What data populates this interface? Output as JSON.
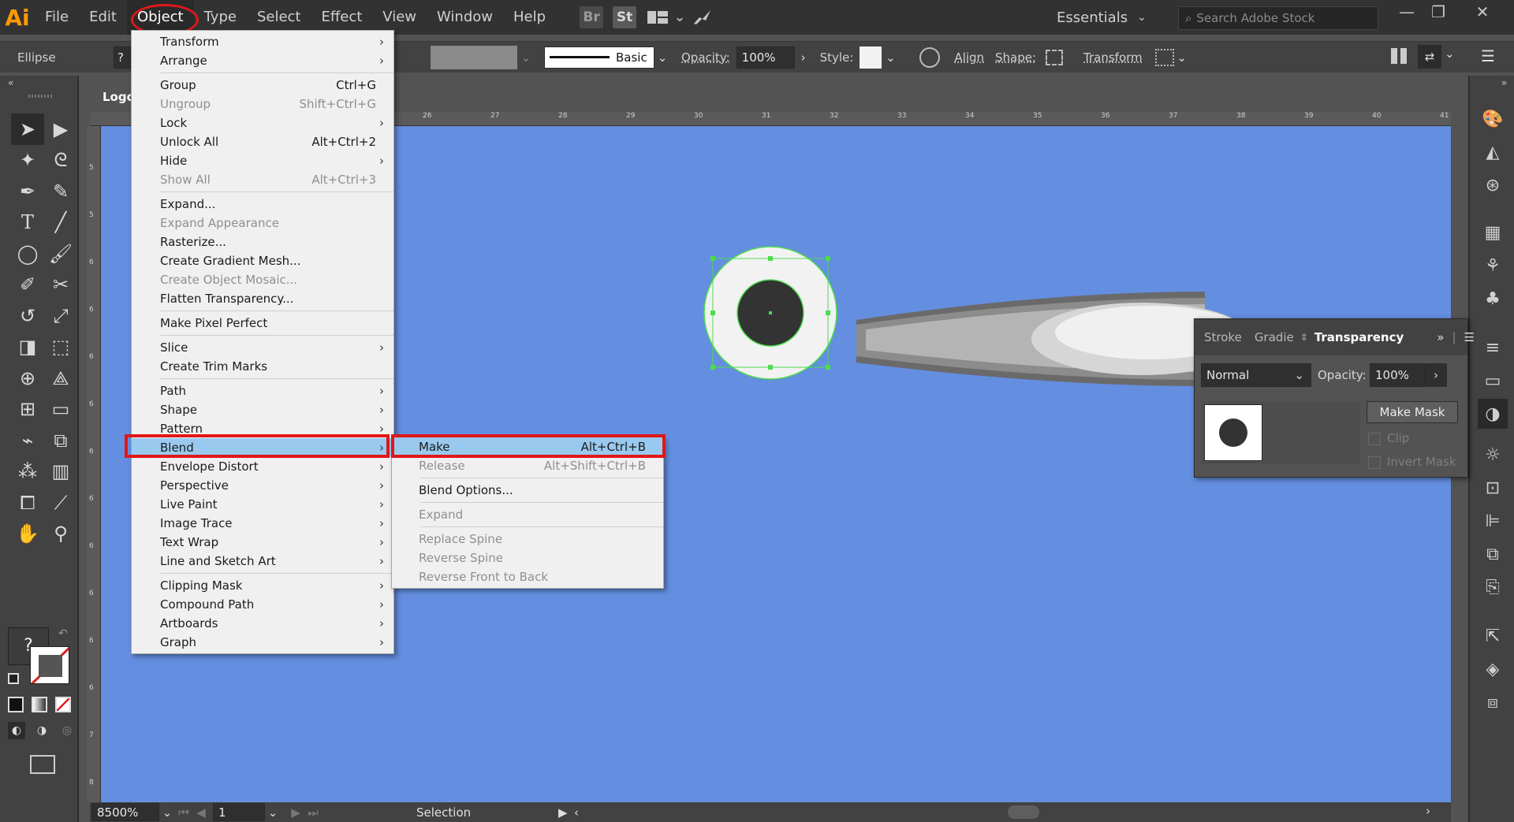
{
  "app": {
    "logo": "Ai",
    "menus": [
      "File",
      "Edit",
      "Object",
      "Type",
      "Select",
      "Effect",
      "View",
      "Window",
      "Help"
    ],
    "active_menu": "Object",
    "bridge_icon": "Br",
    "stock_icon": "St",
    "workspace": "Essentials",
    "search_placeholder": "Search Adobe Stock"
  },
  "control_bar": {
    "selection_type": "Ellipse",
    "stroke_profile": "Basic",
    "opacity_label": "Opacity:",
    "opacity_value": "100%",
    "style_label": "Style:",
    "align_label": "Align",
    "shape_label": "Shape:",
    "transform_label": "Transform"
  },
  "document": {
    "tab_title": "Logo."
  },
  "ruler": {
    "top_ticks": [
      "26",
      "27",
      "28",
      "29",
      "30",
      "31",
      "32",
      "33",
      "34",
      "35",
      "36",
      "37",
      "38",
      "39",
      "40",
      "41"
    ],
    "left_ticks": [
      "5",
      "5",
      "6",
      "6",
      "6",
      "6",
      "6",
      "6",
      "6",
      "6",
      "6",
      "6",
      "7",
      "8"
    ]
  },
  "object_menu": {
    "groups": [
      [
        {
          "label": "Transform",
          "submenu": true
        },
        {
          "label": "Arrange",
          "submenu": true
        }
      ],
      [
        {
          "label": "Group",
          "shortcut": "Ctrl+G"
        },
        {
          "label": "Ungroup",
          "shortcut": "Shift+Ctrl+G",
          "disabled": true
        },
        {
          "label": "Lock",
          "submenu": true
        },
        {
          "label": "Unlock All",
          "shortcut": "Alt+Ctrl+2"
        },
        {
          "label": "Hide",
          "submenu": true
        },
        {
          "label": "Show All",
          "shortcut": "Alt+Ctrl+3",
          "disabled": true
        }
      ],
      [
        {
          "label": "Expand..."
        },
        {
          "label": "Expand Appearance",
          "disabled": true
        },
        {
          "label": "Rasterize..."
        },
        {
          "label": "Create Gradient Mesh..."
        },
        {
          "label": "Create Object Mosaic...",
          "disabled": true
        },
        {
          "label": "Flatten Transparency..."
        }
      ],
      [
        {
          "label": "Make Pixel Perfect"
        }
      ],
      [
        {
          "label": "Slice",
          "submenu": true
        },
        {
          "label": "Create Trim Marks"
        }
      ],
      [
        {
          "label": "Path",
          "submenu": true
        },
        {
          "label": "Shape",
          "submenu": true
        },
        {
          "label": "Pattern",
          "submenu": true
        },
        {
          "label": "Blend",
          "submenu": true,
          "highlighted": true
        },
        {
          "label": "Envelope Distort",
          "submenu": true
        },
        {
          "label": "Perspective",
          "submenu": true
        },
        {
          "label": "Live Paint",
          "submenu": true
        },
        {
          "label": "Image Trace",
          "submenu": true
        },
        {
          "label": "Text Wrap",
          "submenu": true
        },
        {
          "label": "Line and Sketch Art",
          "submenu": true
        }
      ],
      [
        {
          "label": "Clipping Mask",
          "submenu": true
        },
        {
          "label": "Compound Path",
          "submenu": true
        },
        {
          "label": "Artboards",
          "submenu": true
        },
        {
          "label": "Graph",
          "submenu": true
        }
      ]
    ]
  },
  "blend_submenu": {
    "groups": [
      [
        {
          "label": "Make",
          "shortcut": "Alt+Ctrl+B",
          "highlighted": true
        },
        {
          "label": "Release",
          "shortcut": "Alt+Shift+Ctrl+B",
          "disabled": true
        }
      ],
      [
        {
          "label": "Blend Options..."
        }
      ],
      [
        {
          "label": "Expand",
          "disabled": true
        }
      ],
      [
        {
          "label": "Replace Spine",
          "disabled": true
        },
        {
          "label": "Reverse Spine",
          "disabled": true
        },
        {
          "label": "Reverse Front to Back",
          "disabled": true
        }
      ]
    ]
  },
  "transparency_panel": {
    "tabs": [
      "Stroke",
      "Gradie",
      "Transparency"
    ],
    "active_tab": "Transparency",
    "blend_mode": "Normal",
    "opacity_label": "Opacity:",
    "opacity_value": "100%",
    "make_mask_label": "Make Mask",
    "clip_label": "Clip",
    "invert_mask_label": "Invert Mask"
  },
  "status_bar": {
    "zoom": "8500%",
    "artboard": "1",
    "tool": "Selection"
  },
  "colors": {
    "canvas_bg": "#648ee0",
    "menu_highlight": "#99c9ef",
    "annotation_red": "#e01818",
    "selection_green": "#4ddc4d"
  }
}
